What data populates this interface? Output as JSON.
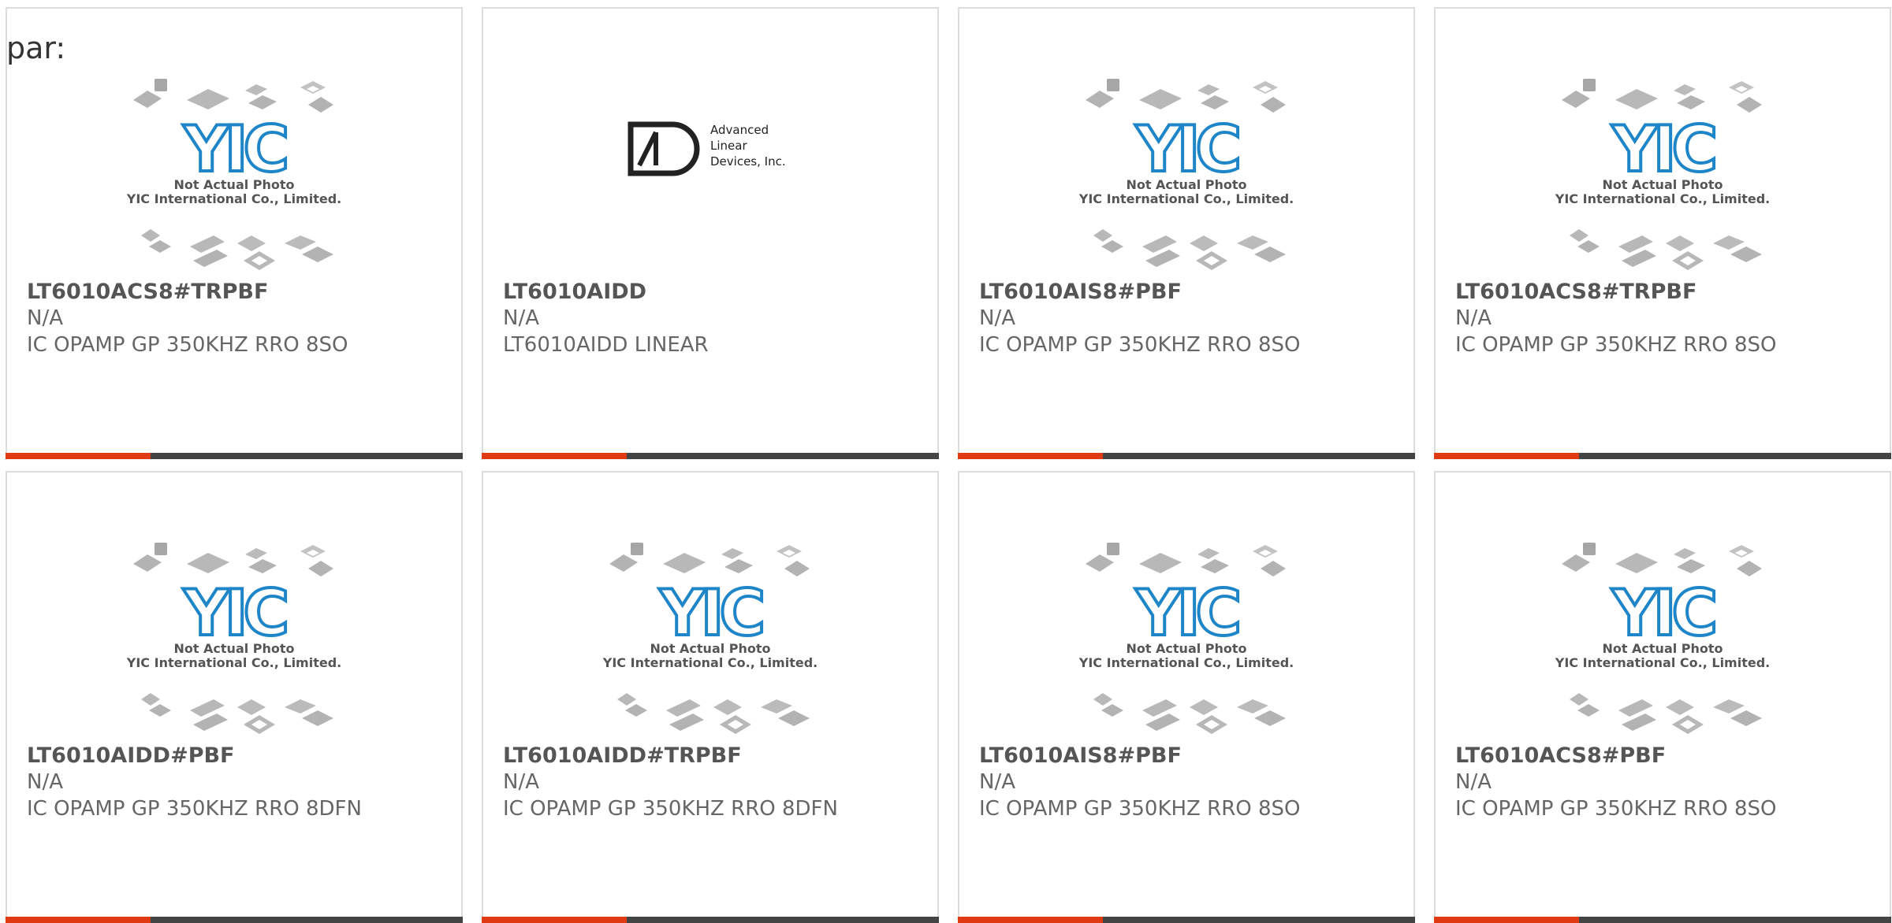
{
  "page_label": "par:",
  "colors": {
    "accent": "#e03a12",
    "bar": "#444444",
    "yic_blue": "#1e86c8",
    "text": "#555555"
  },
  "placeholder": {
    "line1": "Not Actual Photo",
    "line2": "YIC International Co., Limited.",
    "logo": "YIC"
  },
  "adi_logo": {
    "line1": "Advanced",
    "line2": "Linear",
    "line3": "Devices, Inc."
  },
  "cards": [
    {
      "part": "LT6010ACS8#TRPBF",
      "mfr": "N/A",
      "desc": "IC OPAMP GP 350KHZ RRO 8SO",
      "image": "yic-placeholder"
    },
    {
      "part": "LT6010AIDD",
      "mfr": "N/A",
      "desc": "LT6010AIDD LINEAR",
      "image": "adi-logo"
    },
    {
      "part": "LT6010AIS8#PBF",
      "mfr": "N/A",
      "desc": "IC OPAMP GP 350KHZ RRO 8SO",
      "image": "yic-placeholder"
    },
    {
      "part": "LT6010ACS8#TRPBF",
      "mfr": "N/A",
      "desc": "IC OPAMP GP 350KHZ RRO 8SO",
      "image": "yic-placeholder"
    },
    {
      "part": "LT6010AIDD#PBF",
      "mfr": "N/A",
      "desc": "IC OPAMP GP 350KHZ RRO 8DFN",
      "image": "yic-placeholder"
    },
    {
      "part": "LT6010AIDD#TRPBF",
      "mfr": "N/A",
      "desc": "IC OPAMP GP 350KHZ RRO 8DFN",
      "image": "yic-placeholder"
    },
    {
      "part": "LT6010AIS8#PBF",
      "mfr": "N/A",
      "desc": "IC OPAMP GP 350KHZ RRO 8SO",
      "image": "yic-placeholder"
    },
    {
      "part": "LT6010ACS8#PBF",
      "mfr": "N/A",
      "desc": "IC OPAMP GP 350KHZ RRO 8SO",
      "image": "yic-placeholder"
    }
  ]
}
